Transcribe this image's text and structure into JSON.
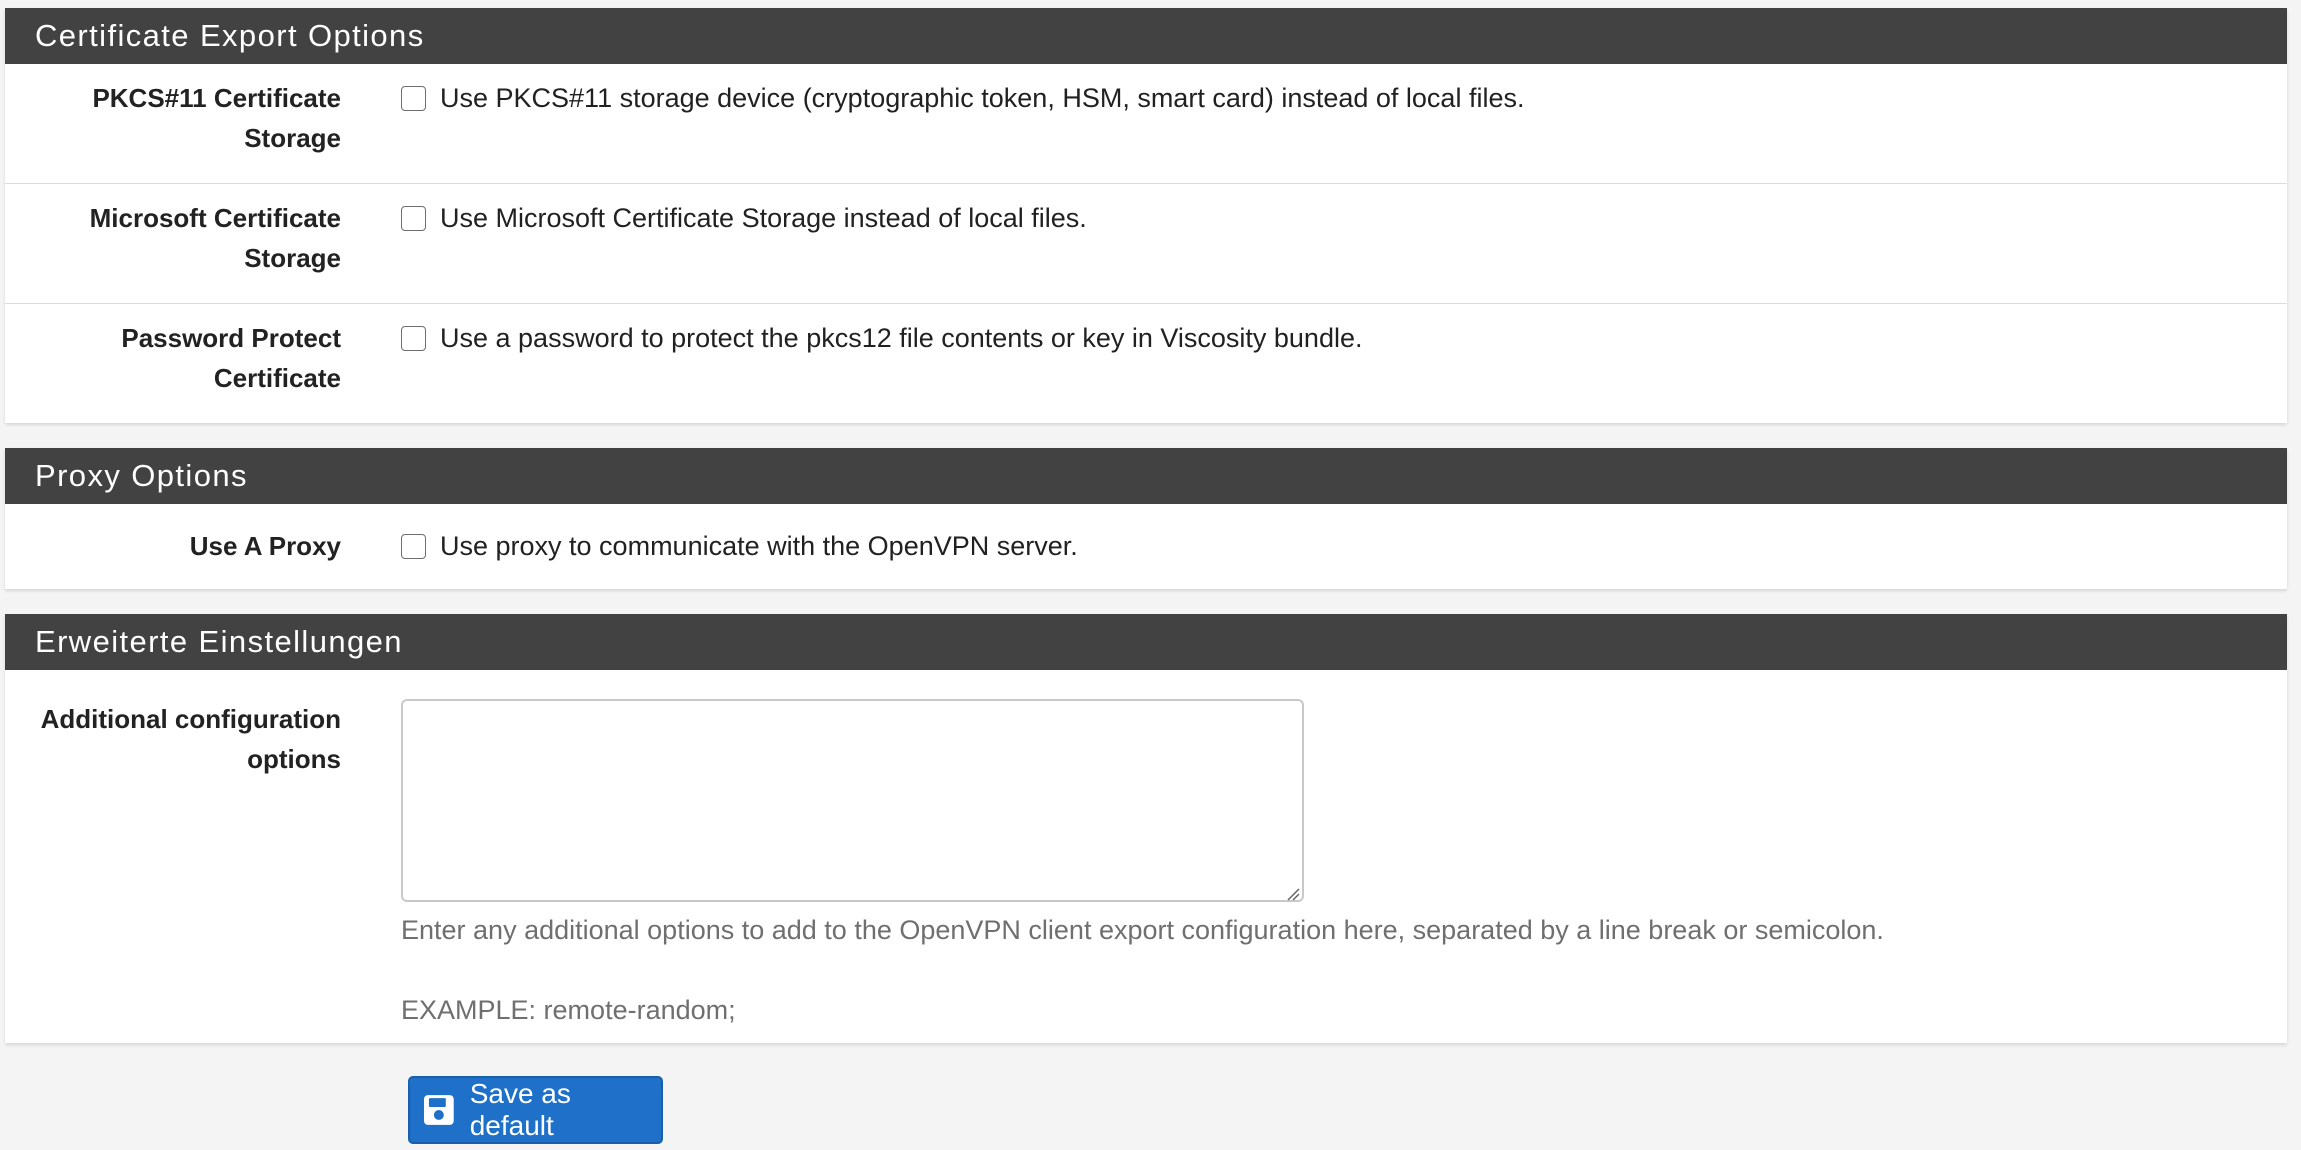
{
  "sections": {
    "cert_export": {
      "title": "Certificate Export Options",
      "rows": [
        {
          "label_line1": "PKCS#11 Certificate",
          "label_line2": "Storage",
          "checkbox_text": "Use PKCS#11 storage device (cryptographic token, HSM, smart card) instead of local files.",
          "checked": false
        },
        {
          "label_line1": "Microsoft Certificate",
          "label_line2": "Storage",
          "checkbox_text": "Use Microsoft Certificate Storage instead of local files.",
          "checked": false
        },
        {
          "label_line1": "Password Protect",
          "label_line2": "Certificate",
          "checkbox_text": "Use a password to protect the pkcs12 file contents or key in Viscosity bundle.",
          "checked": false
        }
      ]
    },
    "proxy": {
      "title": "Proxy Options",
      "rows": [
        {
          "label": "Use A Proxy",
          "checkbox_text": "Use proxy to communicate with the OpenVPN server.",
          "checked": false
        }
      ]
    },
    "advanced": {
      "title": "Erweiterte Einstellungen",
      "label_line1": "Additional configuration",
      "label_line2": "options",
      "textarea_value": "",
      "help_text": "Enter any additional options to add to the OpenVPN client export configuration here, separated by a line break or semicolon.",
      "example_text": "EXAMPLE: remote-random;"
    }
  },
  "save_button": {
    "label": "Save as default",
    "icon": "save-icon"
  },
  "colors": {
    "heading_bg": "#424242",
    "page_bg": "#f4f4f4",
    "button_bg": "#1e70c8",
    "help_text": "#6f6f6f"
  }
}
